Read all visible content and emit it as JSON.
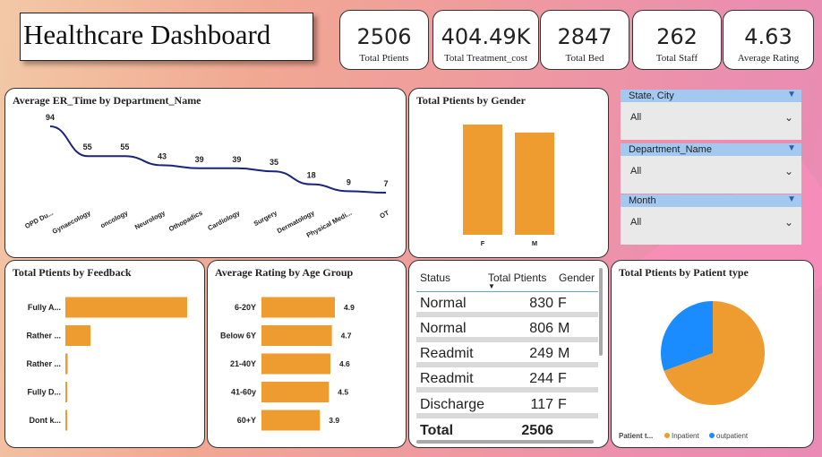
{
  "title": "Healthcare Dashboard",
  "kpis": [
    {
      "value": "2506",
      "label": "Total Ptients"
    },
    {
      "value": "404.49K",
      "label": "Total Treatment_cost"
    },
    {
      "value": "2847",
      "label": "Total Bed"
    },
    {
      "value": "262",
      "label": "Total Staff"
    },
    {
      "value": "4.63",
      "label": "Average Rating"
    }
  ],
  "slicers": [
    {
      "label": "State, City",
      "value": "All"
    },
    {
      "label": "Department_Name",
      "value": "All"
    },
    {
      "label": "Month",
      "value": "All"
    }
  ],
  "table": {
    "headers": [
      "Status",
      "Total Ptients",
      "Gender"
    ],
    "rows": [
      {
        "status": "Normal",
        "count": "830",
        "gender": "F"
      },
      {
        "status": "Normal",
        "count": "806",
        "gender": "M"
      },
      {
        "status": "Readmit",
        "count": "249",
        "gender": "M"
      },
      {
        "status": "Readmit",
        "count": "244",
        "gender": "F"
      },
      {
        "status": "Discharge",
        "count": "117",
        "gender": "F"
      }
    ],
    "total_label": "Total",
    "total_value": "2506"
  },
  "colors": {
    "bar": "#ee9b30",
    "line": "#1a237e",
    "pie_inpatient": "#ee9b30",
    "pie_outpatient": "#1a8cff"
  },
  "chart_data": [
    {
      "type": "line",
      "title": "Average ER_Time by Department_Name",
      "categories": [
        "OPD Du...",
        "Gynaecology",
        "oncology",
        "Neurology",
        "Othopadics",
        "Cardiology",
        "Surgery",
        "Dermatology",
        "Physical Medi...",
        "OT"
      ],
      "values": [
        94,
        55,
        55,
        43,
        39,
        39,
        35,
        18,
        9,
        7
      ]
    },
    {
      "type": "bar",
      "title": "Total Ptients by Gender",
      "categories": [
        "F",
        "M"
      ],
      "values": [
        1300,
        1206
      ]
    },
    {
      "type": "bar",
      "orientation": "horizontal",
      "title": "Total Ptients by Feedback",
      "categories": [
        "Fully A...",
        "Rather ...",
        "Rather ...",
        "Fully D...",
        "Dont k..."
      ],
      "values": [
        1600,
        330,
        30,
        20,
        15
      ]
    },
    {
      "type": "bar",
      "orientation": "horizontal",
      "title": "Average Rating by Age Group",
      "categories": [
        "6-20Y",
        "Below 6Y",
        "21-40Y",
        "41-60y",
        "60+Y"
      ],
      "values": [
        4.9,
        4.7,
        4.6,
        4.5,
        3.9
      ]
    },
    {
      "type": "pie",
      "title": "Total Ptients by Patient type",
      "legend_title": "Patient t...",
      "labels": [
        "Inpatient",
        "outpatient"
      ],
      "values": [
        1740,
        766
      ]
    }
  ]
}
